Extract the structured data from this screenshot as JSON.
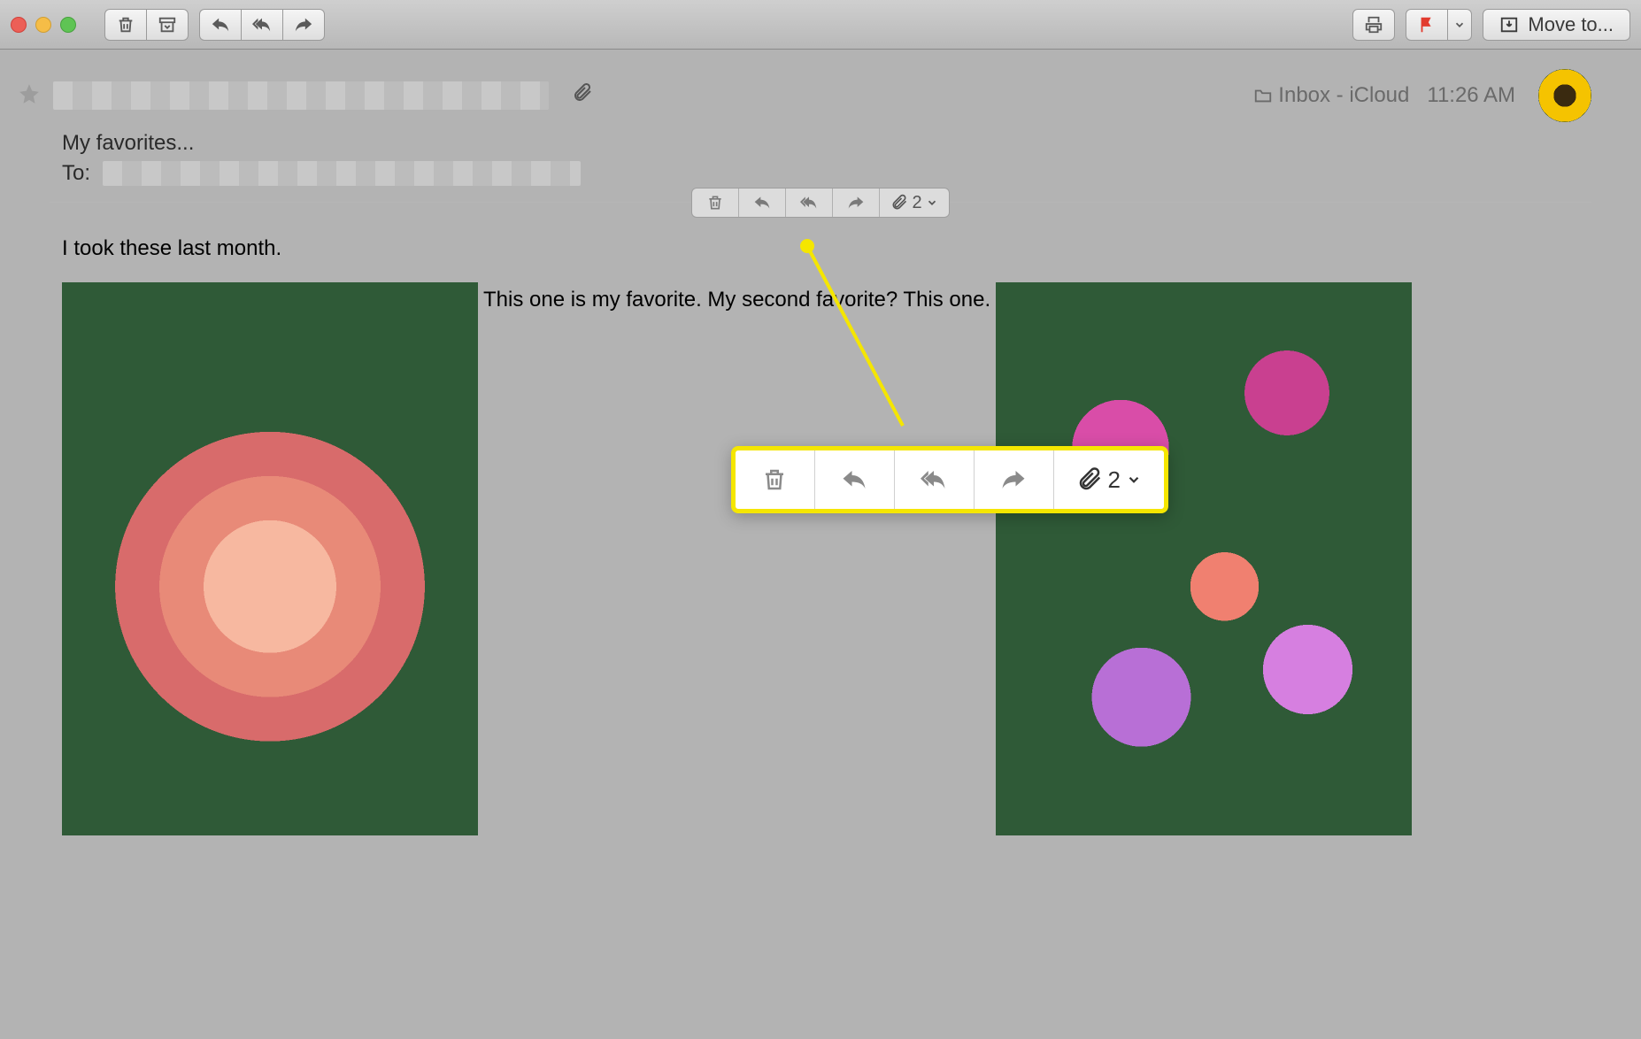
{
  "toolbar": {
    "move_label": "Move to..."
  },
  "header": {
    "mailbox": "Inbox - iCloud",
    "time": "11:26 AM",
    "subject": "My favorites...",
    "to_label": "To:"
  },
  "inline_actions": {
    "attachment_count": "2"
  },
  "callout": {
    "attachment_count": "2"
  },
  "body": {
    "line1": "I took these last month.",
    "mid": "This one is my favorite. My second favorite? This one."
  }
}
